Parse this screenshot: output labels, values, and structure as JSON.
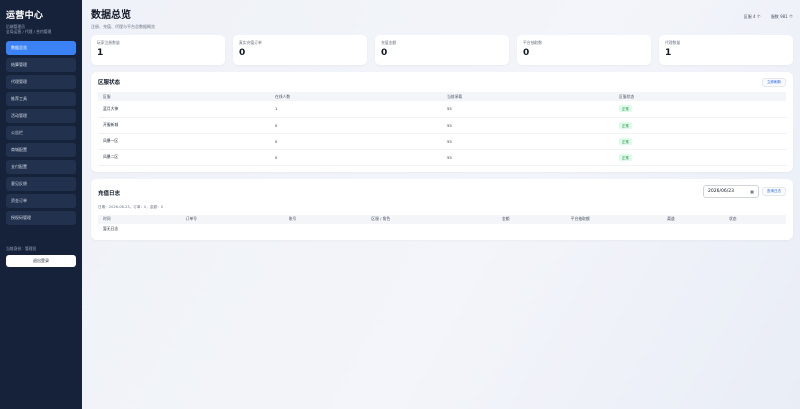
{
  "sidebar": {
    "title": "运营中心",
    "sub1": "后端管理员",
    "sub2": "全局运营 / 代理 / 合约管理",
    "items": [
      {
        "label": "数据总览"
      },
      {
        "label": "结算管理"
      },
      {
        "label": "代理管理"
      },
      {
        "label": "推荐工具"
      },
      {
        "label": "活动管理"
      },
      {
        "label": "公告栏"
      },
      {
        "label": "商城配置"
      },
      {
        "label": "支付配置"
      },
      {
        "label": "意见反馈"
      },
      {
        "label": "资金订单"
      },
      {
        "label": "授权码管理"
      }
    ],
    "current_user": "当前身份：管理员",
    "logout_label": "退出登录"
  },
  "header": {
    "title": "数据总览",
    "desc": "注册、充值、代理与平台总数据概览",
    "meta_1": "区服 4 个",
    "meta_2": "服数 981 个"
  },
  "stats": [
    {
      "label": "玩家注册数量",
      "value": "1"
    },
    {
      "label": "真实充值订单",
      "value": "0"
    },
    {
      "label": "充值金额",
      "value": "0"
    },
    {
      "label": "平台抽取数",
      "value": "0"
    },
    {
      "label": "代理数量",
      "value": "1"
    }
  ],
  "servers": {
    "title": "区服状态",
    "button": "立即刷新",
    "columns": [
      "区服",
      "在线人数",
      "当前承载",
      "区服状态"
    ],
    "rows": [
      {
        "name": "蓝月大神",
        "online": "1",
        "load": "55",
        "status": "正常"
      },
      {
        "name": "开服新城",
        "online": "0",
        "load": "55",
        "status": "正常"
      },
      {
        "name": "风暴一区",
        "online": "0",
        "load": "55",
        "status": "正常"
      },
      {
        "name": "风暴二区",
        "online": "0",
        "load": "55",
        "status": "正常"
      }
    ]
  },
  "recharge": {
    "title": "充值日志",
    "date": "2026/06/23",
    "button": "查询日志",
    "summary": "日期：2026-06-23，订单：0，金额：0",
    "columns": [
      "时间",
      "订单号",
      "账号",
      "区服 / 角色",
      "金额",
      "平台抽取额",
      "渠道",
      "状态"
    ],
    "empty": "暂无日志"
  }
}
